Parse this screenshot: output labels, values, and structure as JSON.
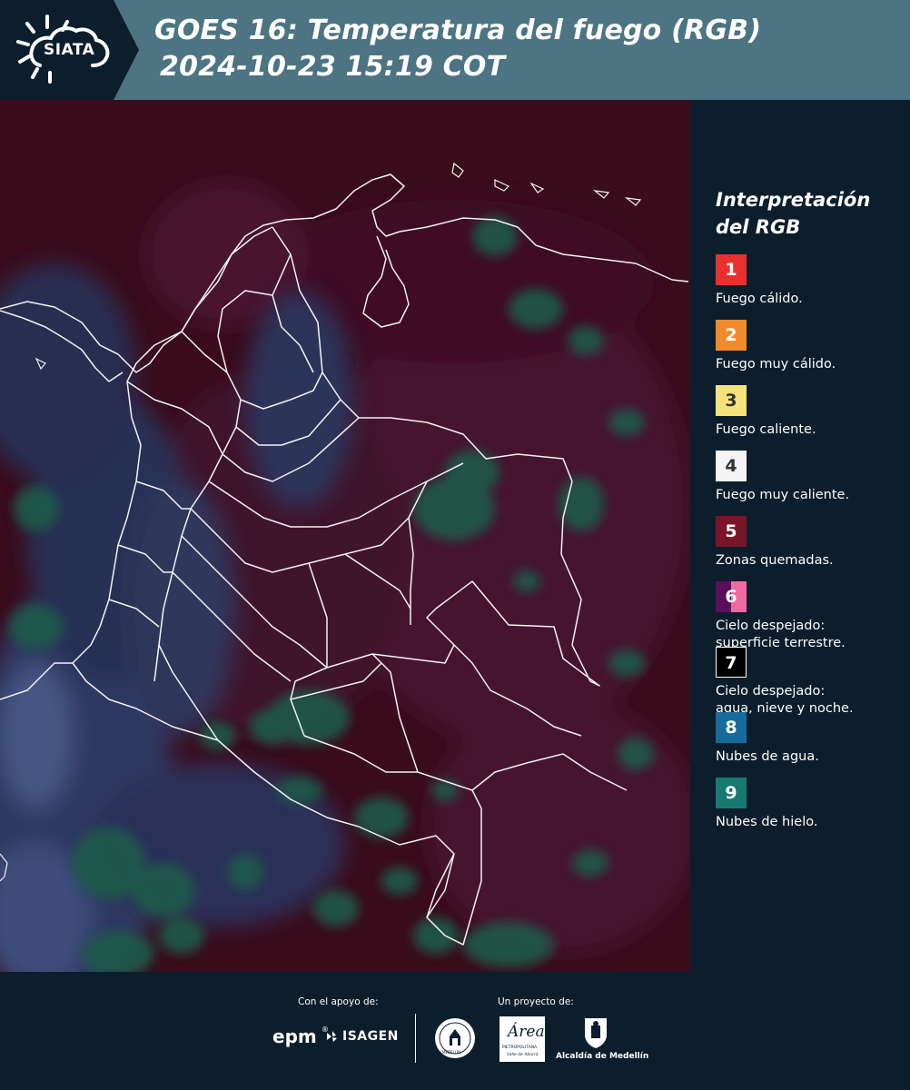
{
  "header": {
    "logo_text": "SIATA",
    "title_line1": "GOES 16: Temperatura del fuego (RGB)",
    "title_line2": "2024-10-23 15:19 COT"
  },
  "legend": {
    "title_line1": "Interpretación",
    "title_line2": "del RGB",
    "items": [
      {
        "number": "1",
        "label": "Fuego cálido.",
        "color": "#e8312f",
        "text_color": "#ffffff"
      },
      {
        "number": "2",
        "label": "Fuego muy cálido.",
        "color": "#f08a2b",
        "text_color": "#ffffff"
      },
      {
        "number": "3",
        "label": "Fuego caliente.",
        "color": "#f5e27a",
        "text_color": "#333333"
      },
      {
        "number": "4",
        "label": "Fuego muy caliente.",
        "color": "#f4f4f4",
        "text_color": "#333333"
      },
      {
        "number": "5",
        "label": "Zonas quemadas.",
        "color": "#7a1428",
        "text_color": "#ffffff"
      },
      {
        "number": "6",
        "label_line1": "Cielo despejado:",
        "label_line2": "superficie terrestre.",
        "color": "#5a0f5c",
        "color2": "#f06aa0",
        "text_color": "#ffffff"
      },
      {
        "number": "7",
        "label_line1": "Cielo despejado:",
        "label_line2": "agua, nieve y noche.",
        "color": "#000000",
        "text_color": "#ffffff"
      },
      {
        "number": "8",
        "label": "Nubes de agua.",
        "color": "#176b9a",
        "text_color": "#ffffff"
      },
      {
        "number": "9",
        "label": "Nubes de hielo.",
        "color": "#167a73",
        "text_color": "#ffffff"
      }
    ]
  },
  "footer": {
    "support_label": "Con el apoyo de:",
    "project_label": "Un proyecto de:",
    "epm": "epm",
    "isagen": "ISAGEN",
    "area_name": "Área",
    "area_sub": "METROPOLITANA",
    "area_sub2": "Valle de Aburrá",
    "alcaldia": "Alcaldía de Medellín",
    "seal_text": "MEDELLÍN"
  },
  "colors": {
    "header_bg": "#4c7482",
    "logo_bg": "#0c1e2c",
    "page_bg": "#0c1e2c",
    "map_base": "#3a0c1c"
  }
}
